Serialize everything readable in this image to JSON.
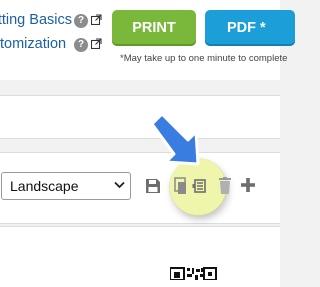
{
  "links": {
    "setting_basics": "tting Basics",
    "customization": "tomization"
  },
  "buttons": {
    "print": "PRINT",
    "pdf": "PDF *"
  },
  "note": "*May take up to one minute to complete",
  "orientation": {
    "selected": "Landscape"
  },
  "icons": {
    "help": "question-circle-icon",
    "external": "external-link-icon",
    "save": "floppy-disk-icon",
    "copy": "copy-icon",
    "settings": "settings-icon",
    "delete": "trash-icon",
    "add": "plus-icon"
  },
  "colors": {
    "link": "#1d5fa6",
    "print_button": "#79b83a",
    "pdf_button": "#1c9ed8",
    "arrow": "#3a7de0",
    "highlight": "#ebf296"
  }
}
